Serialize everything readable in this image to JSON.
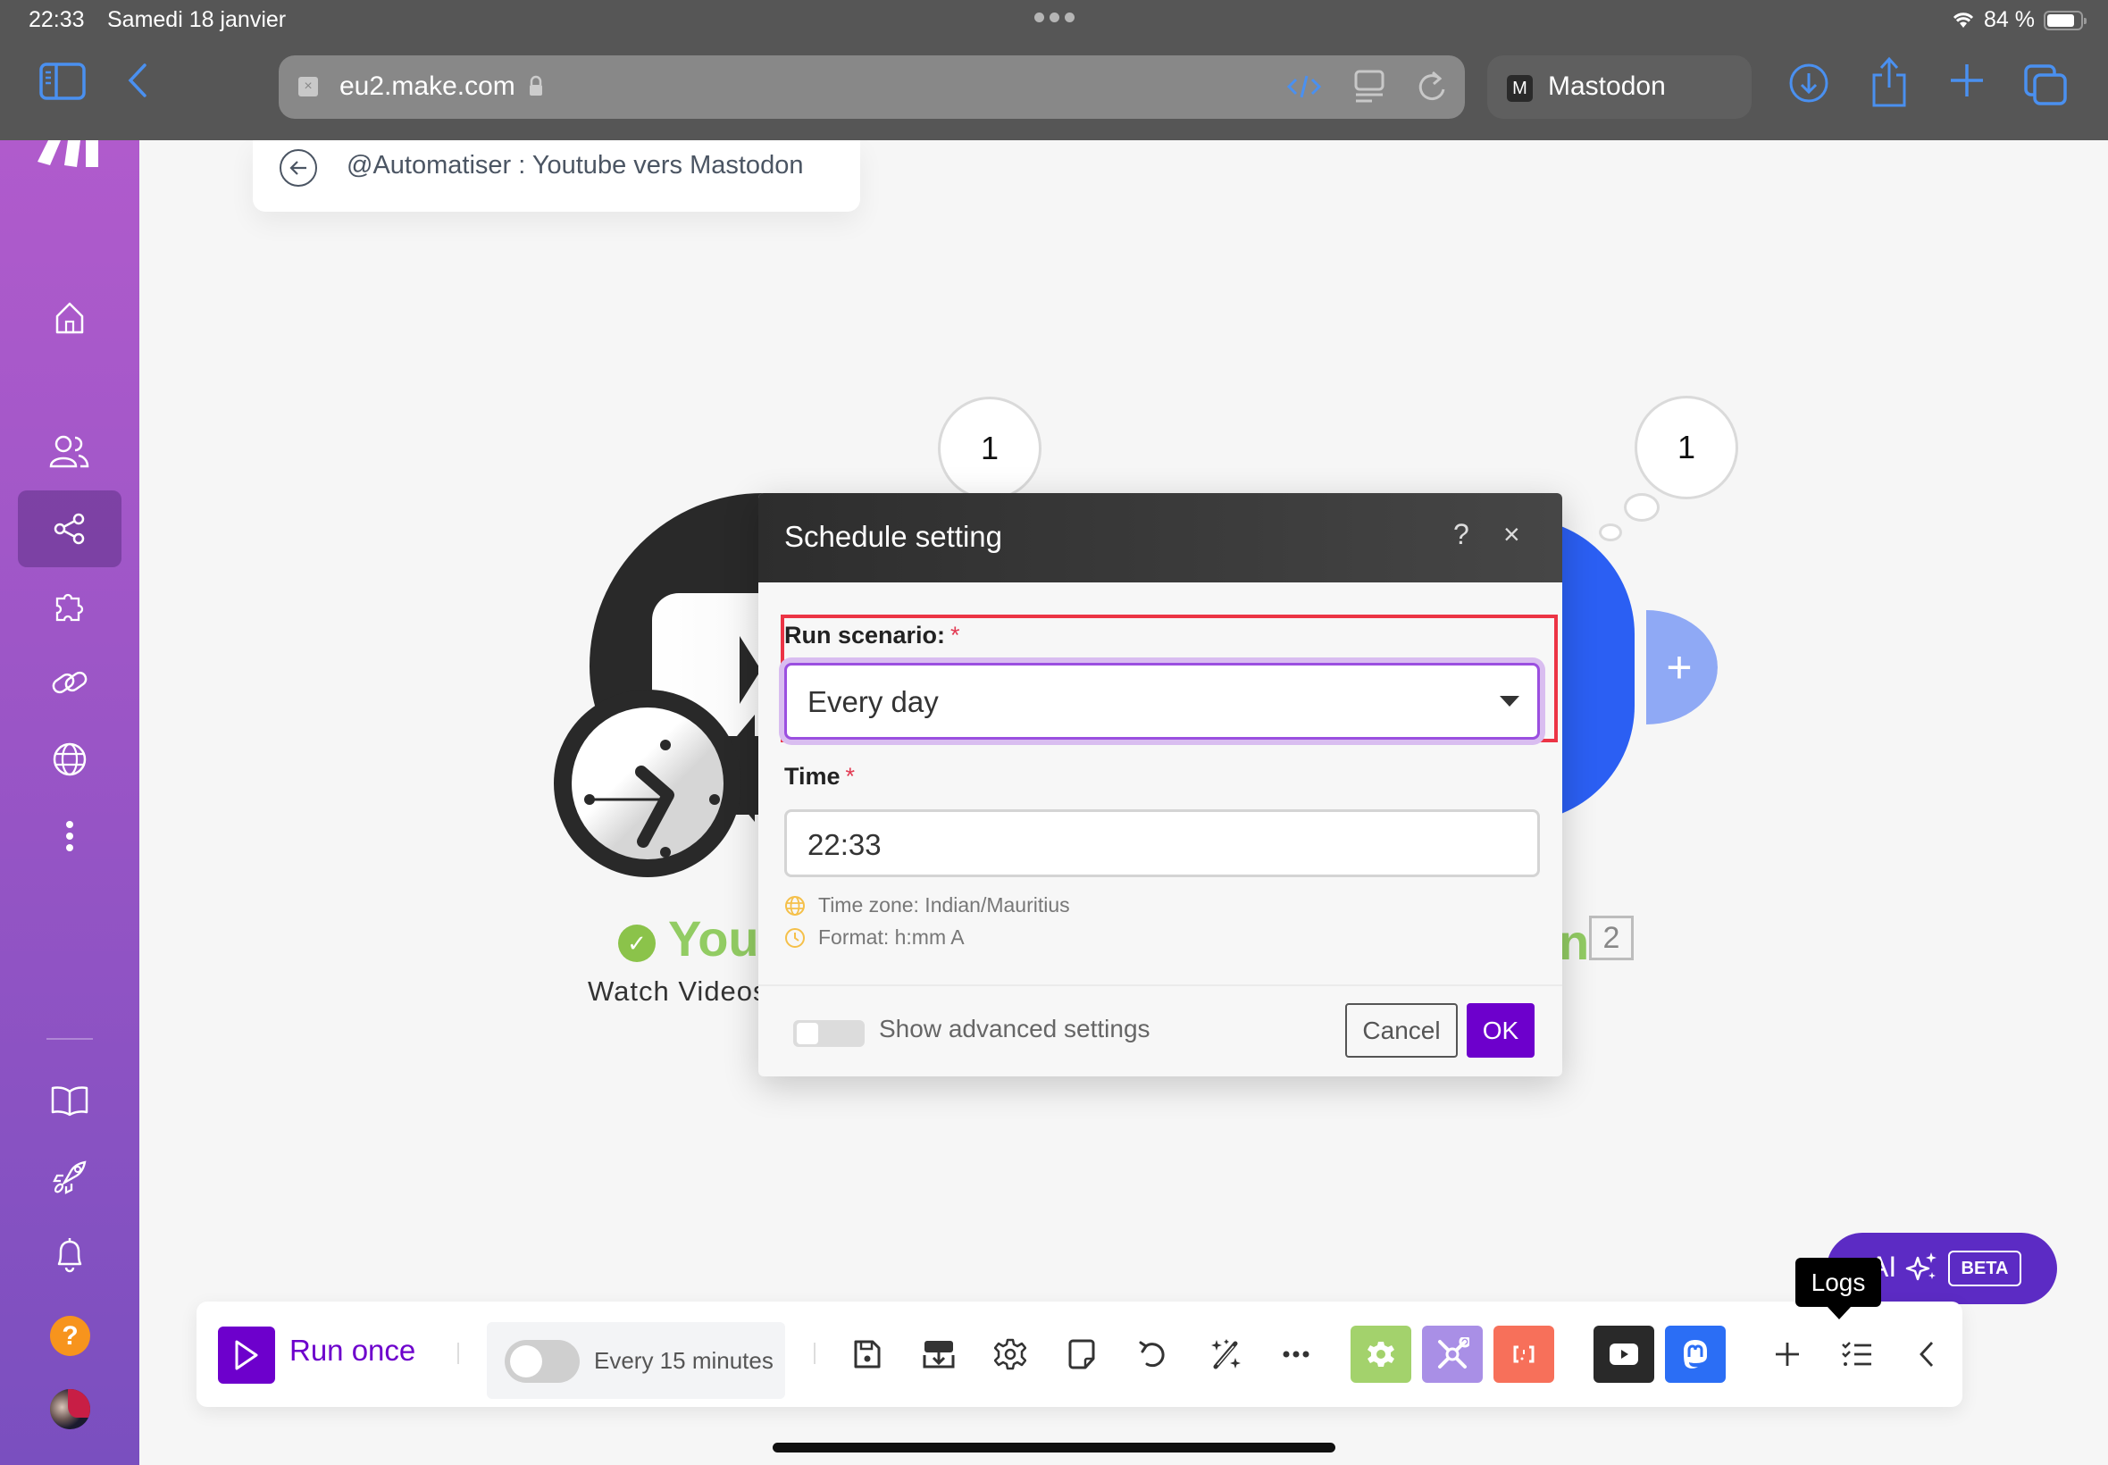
{
  "status_bar": {
    "time": "22:33",
    "date": "Samedi 18 janvier",
    "battery": "84 %"
  },
  "browser": {
    "url": "eu2.make.com",
    "tab_title": "Mastodon",
    "tab_favicon": "M",
    "icons": [
      "sidebar-icon",
      "back-icon",
      "code-icon",
      "reader-icon",
      "reload-icon",
      "download-icon",
      "share-icon",
      "new-tab-icon",
      "tabs-icon"
    ]
  },
  "sidebar": {
    "items": [
      {
        "name": "home",
        "icon": "home-icon"
      },
      {
        "name": "team",
        "icon": "users-icon"
      },
      {
        "name": "scenarios",
        "icon": "share-icon",
        "active": true
      },
      {
        "name": "apps",
        "icon": "puzzle-icon"
      },
      {
        "name": "connections",
        "icon": "link-icon"
      },
      {
        "name": "webhooks",
        "icon": "globe-icon"
      },
      {
        "name": "more",
        "icon": "more-vertical-icon"
      },
      {
        "name": "docs",
        "icon": "book-icon"
      },
      {
        "name": "whats-new",
        "icon": "rocket-icon"
      },
      {
        "name": "notifications",
        "icon": "bell-icon"
      }
    ],
    "help_label": "?",
    "colors": {
      "top": "#b05bcc",
      "bottom": "#7a4fbf",
      "help": "#f7941d"
    }
  },
  "breadcrumb": {
    "title": "@Automatiser : Youtube vers Mastodon"
  },
  "canvas": {
    "youtube_module": {
      "name": "YouTube",
      "visible_name": "YouT",
      "action": "Watch Videos",
      "bubble_count": "1",
      "status": "ok"
    },
    "mastodon_module": {
      "visible_name_tail": "n",
      "bubble_count": "1",
      "module_number": "2",
      "color": "#2b5ff3"
    },
    "add_module_label": "+"
  },
  "modal": {
    "title": "Schedule setting",
    "help_label": "?",
    "close_label": "×",
    "run_scenario": {
      "label": "Run scenario:",
      "required_mark": "*",
      "value": "Every day"
    },
    "time": {
      "label": "Time",
      "required_mark": "*",
      "value": "22:33"
    },
    "hints": {
      "timezone": "Time zone: Indian/Mauritius",
      "format": "Format: h:mm A"
    },
    "advanced_label": "Show advanced settings",
    "advanced_enabled": false,
    "cancel_label": "Cancel",
    "ok_label": "OK",
    "colors": {
      "accent": "#6d00cc",
      "highlight": "#ec3445",
      "focus": "#9b4fe0"
    }
  },
  "toolbar": {
    "run_once_label": "Run once",
    "schedule_label": "Every 15 minutes",
    "schedule_enabled": false,
    "tools": [
      "save-icon",
      "import-icon",
      "settings-icon",
      "notes-icon",
      "undo-icon",
      "auto-align-icon",
      "more-icon"
    ],
    "app_tiles": [
      {
        "name": "tools",
        "color": "#a3d26c"
      },
      {
        "name": "flow-control",
        "color": "#a98fe6"
      },
      {
        "name": "text-parser",
        "color": "#f7705a"
      },
      {
        "name": "youtube",
        "color": "#292929"
      },
      {
        "name": "mastodon",
        "color": "#2b6ef5"
      }
    ],
    "tooltip": "Logs"
  },
  "ai_button": {
    "label": "AI",
    "badge": "BETA"
  }
}
